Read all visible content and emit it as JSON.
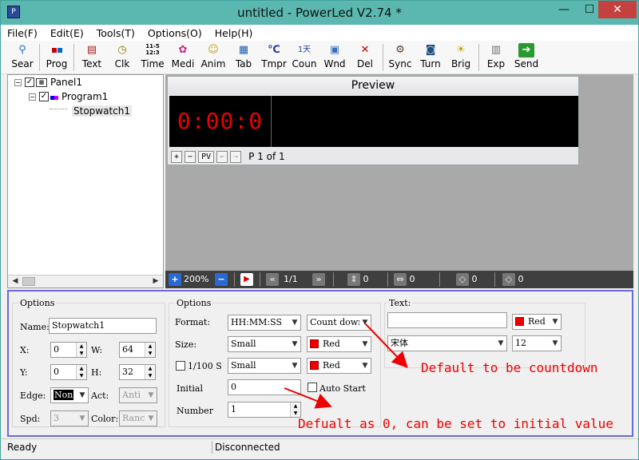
{
  "window": {
    "title": "untitled - PowerLed V2.74 *",
    "app_icon": "app-logo-icon",
    "min": "—",
    "max": "☐",
    "close": "✕"
  },
  "menu": [
    "File(F)",
    "Edit(E)",
    "Tools(T)",
    "Options(O)",
    "Help(H)"
  ],
  "toolbar": [
    {
      "label": "Sear",
      "icon": "search-icon"
    },
    {
      "label": "Prog",
      "icon": "program-icon"
    },
    {
      "label": "Text",
      "icon": "text-icon"
    },
    {
      "label": "Clk",
      "icon": "clock-icon"
    },
    {
      "label": "Time",
      "icon": "time-icon",
      "glyph": "11-5 12:3"
    },
    {
      "label": "Medi",
      "icon": "media-icon"
    },
    {
      "label": "Anim",
      "icon": "animation-icon"
    },
    {
      "label": "Tab",
      "icon": "table-icon"
    },
    {
      "label": "Tmpr",
      "icon": "temperature-icon",
      "glyph": "℃"
    },
    {
      "label": "Coun",
      "icon": "counter-icon",
      "glyph": "1天"
    },
    {
      "label": "Wnd",
      "icon": "window-icon"
    },
    {
      "label": "Del",
      "icon": "delete-icon",
      "glyph": "✕"
    },
    {
      "label": "Sync",
      "icon": "sync-icon"
    },
    {
      "label": "Turn",
      "icon": "turn-icon"
    },
    {
      "label": "Brig",
      "icon": "brightness-icon"
    },
    {
      "label": "Exp",
      "icon": "export-icon"
    },
    {
      "label": "Send",
      "icon": "send-icon"
    }
  ],
  "tree": {
    "panel": "Panel1",
    "program": "Program1",
    "item": "Stopwatch1"
  },
  "preview": {
    "title": "Preview",
    "display": "0:00:0",
    "btn_plus": "+",
    "btn_minus": "−",
    "btn_pv": "PV",
    "btn_prev": "⇐",
    "btn_next": "⇒",
    "page": "P 1 of 1"
  },
  "zoombar": {
    "zoom": "200%",
    "plus": "+",
    "minus": "−",
    "page": "1/1",
    "v_size": "0",
    "h_size": "0",
    "v_pos": "0",
    "h_pos": "0"
  },
  "props": {
    "options1": {
      "title": "Options",
      "name_label": "Name:",
      "name": "Stopwatch1",
      "x_label": "X:",
      "x": "0",
      "w_label": "W:",
      "w": "64",
      "y_label": "Y:",
      "y": "0",
      "h_label": "H:",
      "h": "32",
      "edge_label": "Edge:",
      "edge": "Non",
      "act_label": "Act:",
      "act": "Anti",
      "spd_label": "Spd:",
      "spd": "3",
      "color_label": "Color:",
      "color": "Ranc"
    },
    "options2": {
      "title": "Options",
      "format_label": "Format:",
      "format": "HH:MM:SS",
      "mode": "Count dowr",
      "size_label": "Size:",
      "size": "Small",
      "size_color": "Red",
      "hundredths_label": "1/100 S",
      "hundredths_size": "Small",
      "hundredths_color": "Red",
      "initial_label": "Initial",
      "initial": "0",
      "auto_start_label": "Auto Start",
      "number_label": "Number",
      "number": "1"
    },
    "text": {
      "title": "Text:",
      "value": "",
      "color": "Red",
      "font": "宋体",
      "font_size": "12"
    }
  },
  "annotations": {
    "countdown": "Default to be countdown",
    "initial": "Defualt as 0, can be set to initial value"
  },
  "status": {
    "left": "Ready",
    "right": "Disconnected"
  },
  "colors": {
    "titlebar": "#5ab8b0",
    "led_text": "#e00000",
    "annotation": "#e00000",
    "props_border": "#6a6ad8"
  }
}
